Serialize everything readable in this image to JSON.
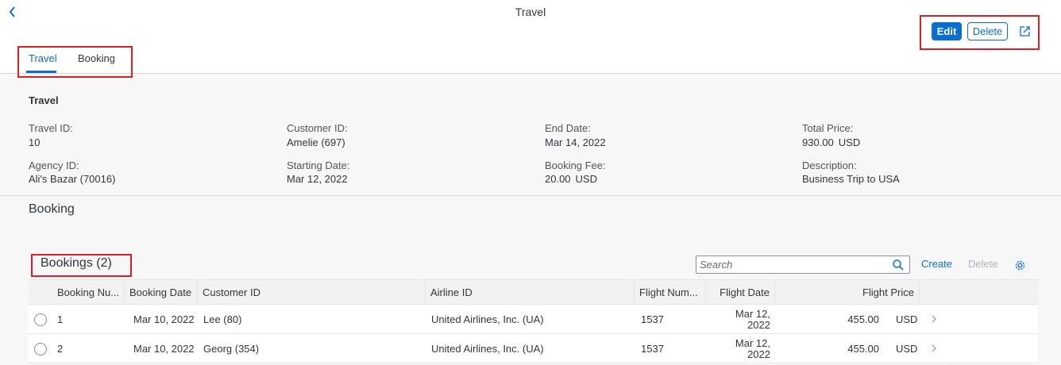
{
  "header": {
    "title": "Travel",
    "edit_label": "Edit",
    "delete_label": "Delete",
    "accent": "#0a6ed1"
  },
  "tabs": [
    {
      "label": "Travel",
      "selected": true
    },
    {
      "label": "Booking",
      "selected": false
    }
  ],
  "travel": {
    "section_title": "Travel",
    "fields": {
      "travel_id": {
        "label": "Travel ID:",
        "value": "10"
      },
      "agency_id": {
        "label": "Agency ID:",
        "value": "Ali's Bazar (70016)"
      },
      "customer_id": {
        "label": "Customer ID:",
        "value": "Amelie (697)"
      },
      "starting_date": {
        "label": "Starting Date:",
        "value": "Mar 12, 2022"
      },
      "end_date": {
        "label": "End Date:",
        "value": "Mar 14, 2022"
      },
      "booking_fee": {
        "label": "Booking Fee:",
        "value": "20.00",
        "unit": "USD"
      },
      "total_price": {
        "label": "Total Price:",
        "value": "930.00",
        "unit": "USD"
      },
      "description": {
        "label": "Description:",
        "value": "Business Trip to USA"
      }
    }
  },
  "booking": {
    "heading": "Booking",
    "table_title": "Bookings (2)",
    "search_placeholder": "Search",
    "create_label": "Create",
    "delete_label": "Delete",
    "columns": [
      "Booking Nu...",
      "Booking Date",
      "Customer ID",
      "Airline ID",
      "Flight Num...",
      "Flight Date",
      "Flight Price"
    ],
    "rows": [
      {
        "booking_number": "1",
        "booking_date": "Mar 10, 2022",
        "customer_id": "Lee (80)",
        "airline_id": "United Airlines, Inc. (UA)",
        "flight_number": "1537",
        "flight_date_line1": "Mar 12,",
        "flight_date_line2": "2022",
        "flight_price": "455.00",
        "currency": "USD"
      },
      {
        "booking_number": "2",
        "booking_date": "Mar 10, 2022",
        "customer_id": "Georg (354)",
        "airline_id": "United Airlines, Inc. (UA)",
        "flight_number": "1537",
        "flight_date_line1": "Mar 12,",
        "flight_date_line2": "2022",
        "flight_price": "455.00",
        "currency": "USD"
      }
    ]
  },
  "icons": {
    "back": "chevron-left-icon",
    "share": "share-icon",
    "search": "search-icon",
    "settings": "gear-icon",
    "row_nav": "chevron-right-icon"
  }
}
